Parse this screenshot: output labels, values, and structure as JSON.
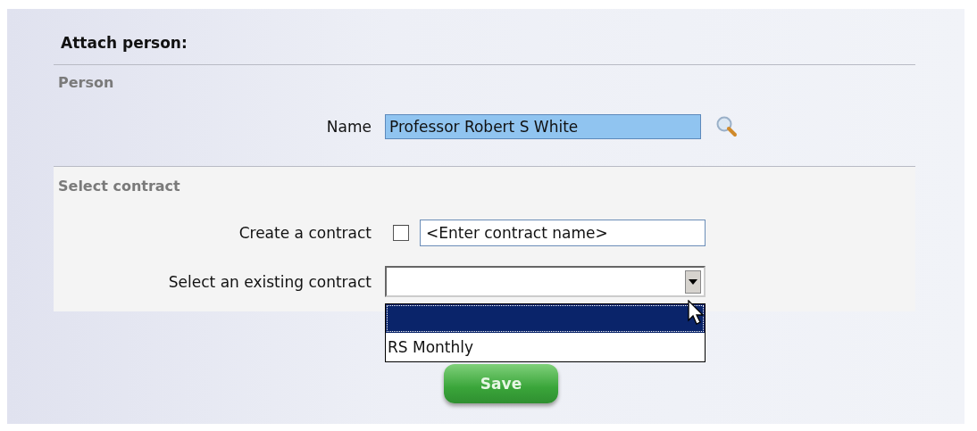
{
  "title": "Attach person:",
  "person": {
    "heading": "Person",
    "name_label": "Name",
    "name_value": "Professor Robert S White"
  },
  "contract": {
    "heading": "Select contract",
    "create_label": "Create a contract",
    "create_checked": false,
    "create_placeholder": "<Enter contract name>",
    "select_label": "Select an existing contract",
    "select_expanded": true,
    "options": [
      {
        "selected": true
      },
      {
        "label": "RS Monthly",
        "selected": false
      }
    ]
  },
  "buttons": [
    "Save"
  ]
}
